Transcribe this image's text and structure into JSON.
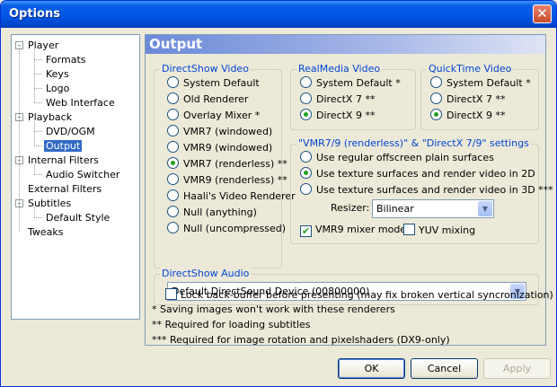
{
  "window": {
    "title": "Options"
  },
  "tree": {
    "items": [
      {
        "label": "Player",
        "expander": "-"
      },
      {
        "label": "Formats"
      },
      {
        "label": "Keys"
      },
      {
        "label": "Logo"
      },
      {
        "label": "Web Interface"
      },
      {
        "label": "Playback",
        "expander": "-"
      },
      {
        "label": "DVD/OGM"
      },
      {
        "label": "Output",
        "selected": true
      },
      {
        "label": "Internal Filters",
        "expander": "-"
      },
      {
        "label": "Audio Switcher"
      },
      {
        "label": "External Filters"
      },
      {
        "label": "Subtitles",
        "expander": "-"
      },
      {
        "label": "Default Style"
      },
      {
        "label": "Tweaks"
      }
    ]
  },
  "page": {
    "title": "Output",
    "directshow_video": {
      "legend": "DirectShow Video",
      "options": [
        "System Default",
        "Old Renderer",
        "Overlay Mixer *",
        "VMR7 (windowed)",
        "VMR9 (windowed)",
        "VMR7 (renderless) **",
        "VMR9 (renderless) **",
        "Haali's Video Renderer",
        "Null (anything)",
        "Null (uncompressed)"
      ],
      "selected_index": 5
    },
    "realmedia_video": {
      "legend": "RealMedia Video",
      "options": [
        "System Default *",
        "DirectX 7 **",
        "DirectX 9 **"
      ],
      "selected_index": 2
    },
    "quicktime_video": {
      "legend": "QuickTime Video",
      "options": [
        "System Default *",
        "DirectX 7 **",
        "DirectX 9 **"
      ],
      "selected_index": 2
    },
    "vmr_settings": {
      "legend": "\"VMR7/9 (renderless)\" & \"DirectX 7/9\" settings",
      "options": [
        "Use regular offscreen plain surfaces",
        "Use texture surfaces and render video in 2D",
        "Use texture surfaces and render video in 3D ***"
      ],
      "selected_index": 1,
      "resizer_label": "Resizer:",
      "resizer_value": "Bilinear",
      "vmr9_mixer_label": "VMR9 mixer mode",
      "vmr9_mixer_checked": true,
      "yuv_mixing_label": "YUV mixing",
      "yuv_mixing_checked": false
    },
    "directshow_audio": {
      "legend": "DirectShow Audio",
      "device": "Default DirectSound Device (00800000)"
    },
    "lock_backbuffer": {
      "label": "Lock back-buffer before presenting (may fix broken vertical syncronization)",
      "checked": false
    },
    "notes": [
      "* Saving images won't work with these renderers",
      "** Required for loading subtitles",
      "*** Required for image rotation and pixelshaders (DX9-only)"
    ]
  },
  "buttons": {
    "ok": "OK",
    "cancel": "Cancel",
    "apply": "Apply"
  },
  "icons": {
    "close": "close-icon",
    "radio": "radio-button",
    "checkbox": "checkbox",
    "dropdown": "chevron-down-icon"
  }
}
